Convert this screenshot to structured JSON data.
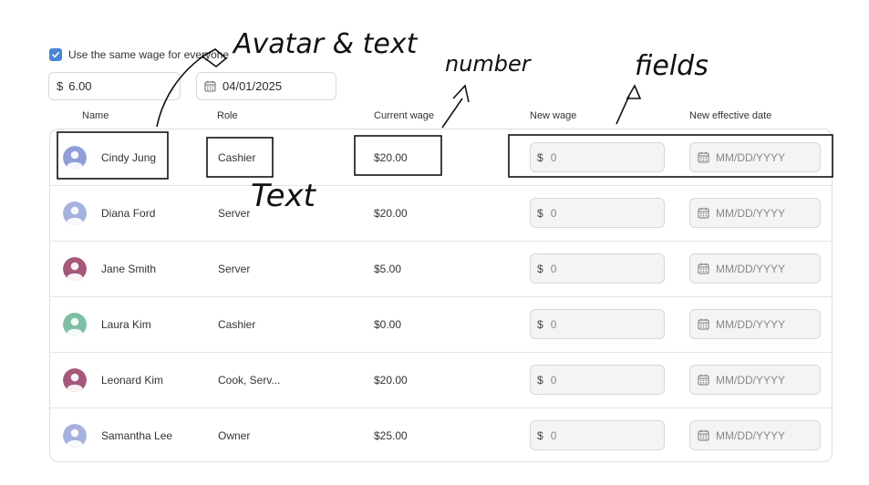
{
  "settings": {
    "same_wage_label": "Use the same wage for everyone",
    "same_wage_checked": true,
    "wage_prefix": "$",
    "wage_value": "6.00",
    "date_value": "04/01/2025"
  },
  "columns": {
    "name": "Name",
    "role": "Role",
    "current_wage": "Current wage",
    "new_wage": "New wage",
    "new_effective_date": "New effective date"
  },
  "rows": [
    {
      "name": "Cindy Jung",
      "role": "Cashier",
      "current_wage": "$20.00",
      "new_wage_prefix": "$",
      "new_wage_placeholder": "0",
      "date_placeholder": "MM/DD/YYYY",
      "avatar_color": "#8f9ed6"
    },
    {
      "name": "Diana Ford",
      "role": "Server",
      "current_wage": "$20.00",
      "new_wage_prefix": "$",
      "new_wage_placeholder": "0",
      "date_placeholder": "MM/DD/YYYY",
      "avatar_color": "#a6b1e0"
    },
    {
      "name": "Jane Smith",
      "role": "Server",
      "current_wage": "$5.00",
      "new_wage_prefix": "$",
      "new_wage_placeholder": "0",
      "date_placeholder": "MM/DD/YYYY",
      "avatar_color": "#a8577c"
    },
    {
      "name": "Laura Kim",
      "role": "Cashier",
      "current_wage": "$0.00",
      "new_wage_prefix": "$",
      "new_wage_placeholder": "0",
      "date_placeholder": "MM/DD/YYYY",
      "avatar_color": "#7cbfa5"
    },
    {
      "name": "Leonard Kim",
      "role": "Cook, Serv...",
      "current_wage": "$20.00",
      "new_wage_prefix": "$",
      "new_wage_placeholder": "0",
      "date_placeholder": "MM/DD/YYYY",
      "avatar_color": "#a8577c"
    },
    {
      "name": "Samantha Lee",
      "role": "Owner",
      "current_wage": "$25.00",
      "new_wage_prefix": "$",
      "new_wage_placeholder": "0",
      "date_placeholder": "MM/DD/YYYY",
      "avatar_color": "#a6b1e0"
    }
  ],
  "annotations": {
    "avatar_text": "Avatar & text",
    "number": "number",
    "fields": "fields",
    "text": "Text"
  },
  "icons": {
    "checkbox": "check-icon",
    "calendar": "calendar-icon",
    "avatar": "person-icon"
  }
}
